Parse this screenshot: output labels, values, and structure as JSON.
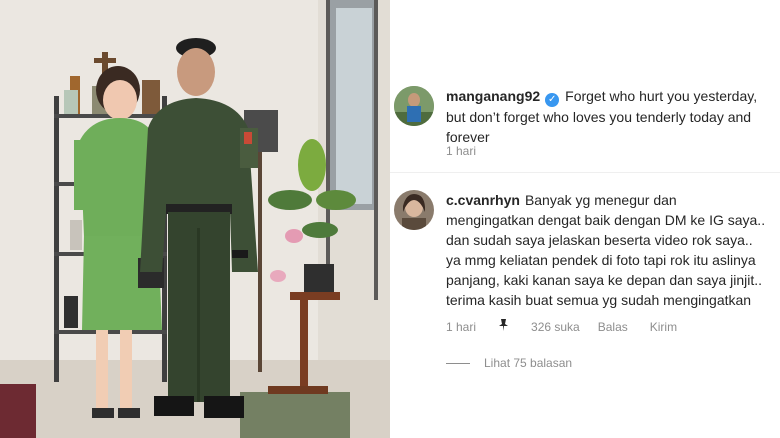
{
  "post": {
    "caption": {
      "username": "manganang92",
      "text": "Forget who hurt you yesterday, but don’t forget who loves you tenderly today and forever",
      "time": "1 hari"
    }
  },
  "comment": {
    "username": "c.cvanrhyn",
    "text": "Banyak yg menegur dan mengingatkan dengat baik dengan DM ke IG saya.. dan sudah saya jelaskan beserta video rok saya.. ya mmg keliatan pendek di foto tapi rok itu aslinya panjang, kaki kanan saya ke depan dan saya jinjit.. terima kasih buat semua yg sudah mengingatkan",
    "time": "1 hari",
    "likes": "326 suka",
    "reply_label": "Balas",
    "send_label": "Kirim",
    "view_replies": "Lihat 75 balasan"
  },
  "icons": {
    "verified": "verified-badge-icon",
    "pin": "pin-icon"
  },
  "colors": {
    "verified_blue": "#3897f0",
    "text": "#262626",
    "meta": "#8e8e8e"
  }
}
